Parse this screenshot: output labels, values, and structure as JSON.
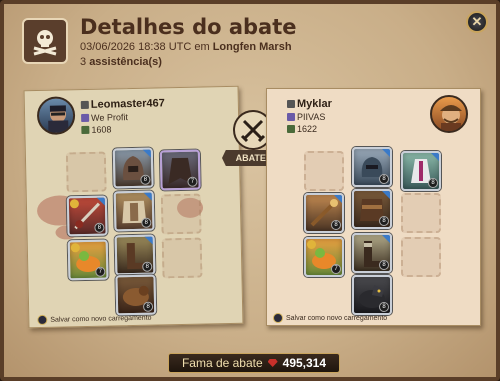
{
  "header": {
    "title": "Detalhes do abate",
    "date": "03/06/2026 18:38 UTC em",
    "location": "Longfen Marsh",
    "assists_count": "3",
    "assists_label": "assistência(s)",
    "icon": "skull-crossbones-icon"
  },
  "vs": {
    "label": "ABATEU",
    "icon": "crossed-swords-icon"
  },
  "killer": {
    "name": "Leomaster467",
    "guild": "We Profit",
    "item_power": "1608",
    "save_label": "Salvar como novo carregamento"
  },
  "victim": {
    "name": "Myklar",
    "guild": "PIIVAS",
    "item_power": "1622",
    "save_label": "Salvar como novo carregamento"
  },
  "fame": {
    "label": "Fama de abate",
    "value": "495,314"
  },
  "colors": {
    "panel_left": "#e0d4b4",
    "panel_right": "#efdcc4",
    "accent": "#c9a45c",
    "blood": "#962820"
  }
}
